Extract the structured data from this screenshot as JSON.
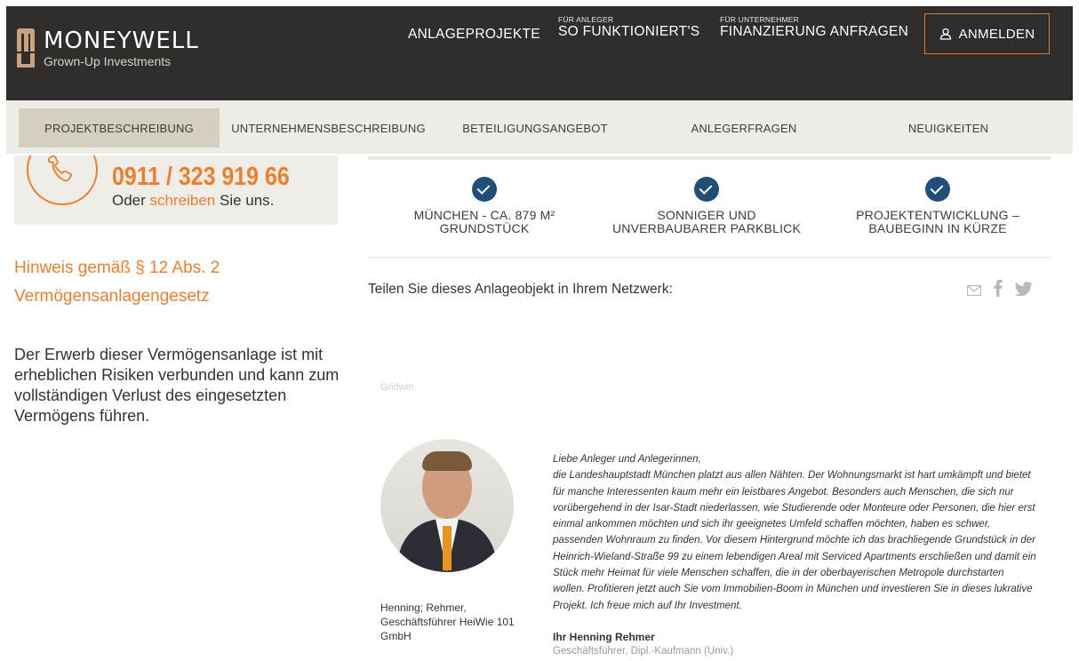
{
  "header": {
    "logo_name": "MONEYWELL",
    "logo_tagline": "Grown-Up Investments",
    "nav": [
      {
        "small": "",
        "label": "ANLAGEPROJEKTE"
      },
      {
        "small": "FÜR ANLEGER",
        "label": "SO FUNKTIONIERT'S"
      },
      {
        "small": "FÜR UNTERNEHMER",
        "label": "FINANZIERUNG ANFRAGEN"
      }
    ],
    "login_label": "ANMELDEN"
  },
  "tabs": [
    {
      "label": "PROJEKTBESCHREIBUNG",
      "active": true
    },
    {
      "label": "UNTERNEHMENSBESCHREIBUNG",
      "active": false
    },
    {
      "label": "BETEILIGUNGSANGEBOT",
      "active": false
    },
    {
      "label": "ANLEGERFRAGEN",
      "active": false
    },
    {
      "label": "NEUIGKEITEN",
      "active": false
    }
  ],
  "contact": {
    "phone": "0911 / 323 919 66",
    "sub_prefix": "Oder",
    "sub_link": "schreiben",
    "sub_suffix": "Sie uns."
  },
  "notice": {
    "title": "Hinweis gemäß § 12 Abs. 2 Vermögensanlagengesetz",
    "text": "Der Erwerb dieser Vermögensanlage ist mit erheblichen Risiken verbunden und kann zum vollständigen Verlust des eingesetzten Vermögens führen."
  },
  "features": [
    {
      "line1": "MÜNCHEN - CA. 879 M²",
      "line2": "GRUNDSTÜCK"
    },
    {
      "line1": "SONNIGER UND",
      "line2": "UNVERBAUBARER PARKBLICK"
    },
    {
      "line1": "PROJEKTENTWICKLUNG –",
      "line2": "BAUBEGINN IN KÜRZE"
    }
  ],
  "share": {
    "text": "Teilen Sie dieses Anlageobjekt in Ihrem Netzwerk:",
    "icons": [
      "mail-icon",
      "facebook-icon",
      "twitter-icon"
    ]
  },
  "gridwin_label": "Gridwin",
  "caption": "Henning; Rehmer, Geschäftsführer HeiWie 101 GmbH",
  "letter": {
    "greeting": "Liebe Anleger und Anlegerinnen,",
    "body": "die Landeshauptstadt München platzt aus allen Nähten. Der Wohnungsmarkt ist hart umkämpft und bietet für manche Interessenten kaum mehr ein leistbares Angebot. Besonders auch Menschen, die sich nur vorübergehend in der Isar-Stadt niederlassen, wie Studierende oder Monteure oder Personen, die hier erst einmal ankommen möchten und sich ihr geeignetes Umfeld schaffen möchten, haben es schwer, passenden Wohnraum zu finden. Vor diesem Hintergrund möchte ich das brachliegende Grundstück in der Heinrich-Wieland-Straße 99 zu einem lebendigen Areal mit Serviced Apartments erschließen und damit ein Stück mehr Heimat für viele Menschen schaffen, die in der oberbayerischen Metropole durchstarten wollen. Profitieren jetzt auch Sie vom Immobilien-Boom in München und investieren Sie in dieses lukrative Projekt. Ich freue mich auf Ihr Investment.",
    "signature": "Ihr Henning Rehmer",
    "role": "Geschäftsführer, Dipl.-Kaufmann (Univ.)"
  },
  "colors": {
    "header_bg": "#2f2e2c",
    "accent_orange": "#f07d2a",
    "check_blue": "#1f4e79",
    "tab_bg": "#eeece7",
    "tab_active": "#d4cfc1"
  }
}
